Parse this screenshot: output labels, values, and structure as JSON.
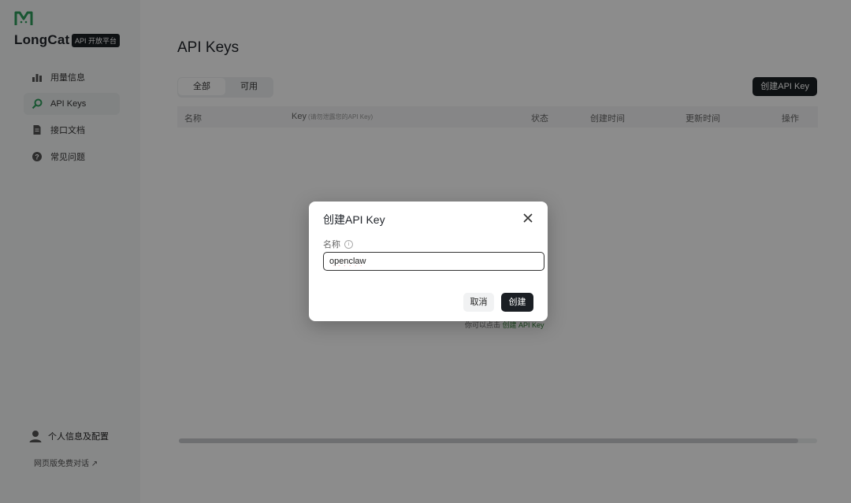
{
  "sidebar": {
    "brand": "LongCat",
    "badge": "API 开放平台",
    "items": [
      {
        "label": "用量信息",
        "icon": "bar-chart-icon"
      },
      {
        "label": "API Keys",
        "icon": "key-icon",
        "active": true
      },
      {
        "label": "接口文档",
        "icon": "document-icon"
      },
      {
        "label": "常见问题",
        "icon": "help-icon"
      }
    ],
    "user_label": "个人信息及配置",
    "web_link": "网页版免费对话 ↗"
  },
  "main": {
    "title": "API Keys",
    "tabs": [
      {
        "label": "全部",
        "active": true
      },
      {
        "label": "可用"
      }
    ],
    "create_button": "创建API Key",
    "table": {
      "columns": [
        "名称",
        "Key",
        "状态",
        "创建时间",
        "更新时间",
        "操作"
      ],
      "key_hint": "(请勿泄露您的API Key)"
    },
    "empty_prefix": "你可以点击",
    "empty_link": "创建 API Key"
  },
  "modal": {
    "title": "创建API Key",
    "field_label": "名称",
    "info_symbol": "i",
    "input_value": "openclaw",
    "cancel": "取消",
    "confirm": "创建"
  },
  "colors": {
    "brand_green": "#2e9d5c",
    "dark_button": "#1b1f24"
  }
}
